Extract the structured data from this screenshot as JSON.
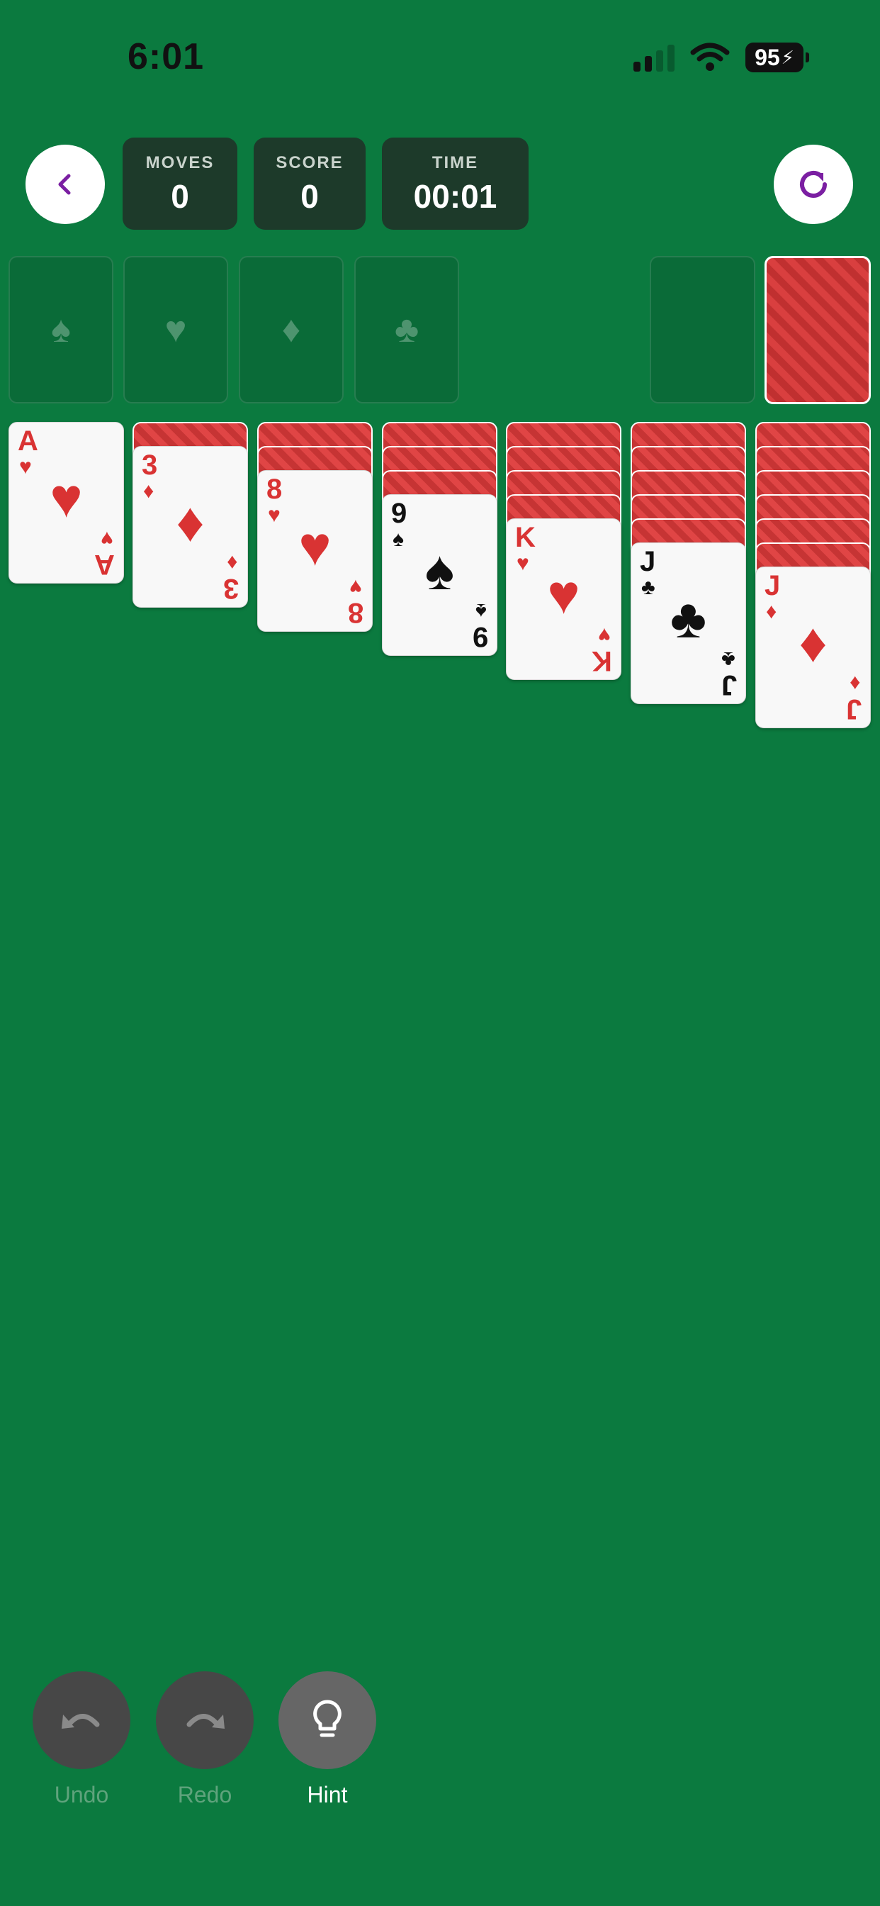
{
  "status_bar": {
    "time": "6:01",
    "battery": "95"
  },
  "header": {
    "stats": [
      {
        "label": "MOVES",
        "value": "0"
      },
      {
        "label": "SCORE",
        "value": "0"
      },
      {
        "label": "TIME",
        "value": "00:01"
      }
    ]
  },
  "foundations": [
    "♠",
    "♥",
    "♦",
    "♣"
  ],
  "tableau": [
    {
      "face_down": 0,
      "rank": "A",
      "suit": "♥",
      "color": "red"
    },
    {
      "face_down": 1,
      "rank": "3",
      "suit": "♦",
      "color": "red"
    },
    {
      "face_down": 2,
      "rank": "8",
      "suit": "♥",
      "color": "red"
    },
    {
      "face_down": 3,
      "rank": "9",
      "suit": "♠",
      "color": "black"
    },
    {
      "face_down": 4,
      "rank": "K",
      "suit": "♥",
      "color": "red"
    },
    {
      "face_down": 5,
      "rank": "J",
      "suit": "♣",
      "color": "black"
    },
    {
      "face_down": 6,
      "rank": "J",
      "suit": "♦",
      "color": "red"
    }
  ],
  "controls": {
    "undo": "Undo",
    "redo": "Redo",
    "hint": "Hint"
  },
  "colors": {
    "felt": "#0b7a3f",
    "card_back": "#d93f3f",
    "red_suit": "#d93333",
    "accent": "#7b1fa2"
  }
}
